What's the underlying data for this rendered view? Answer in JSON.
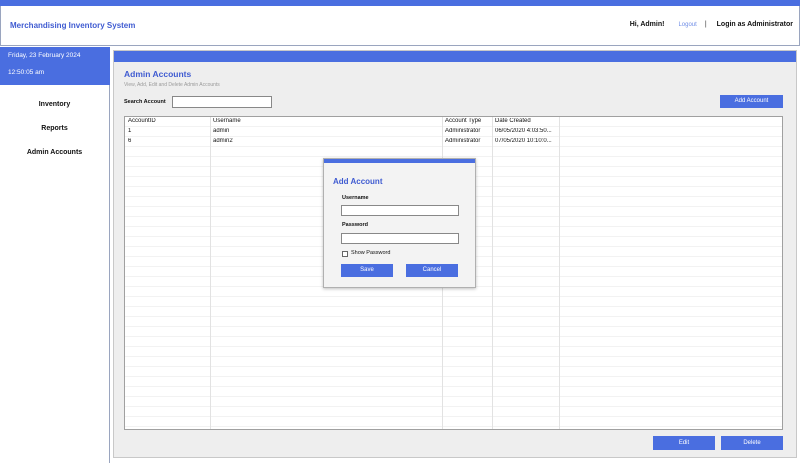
{
  "header": {
    "app_title": "Merchandising Inventory System",
    "greeting": "Hi, Admin!",
    "logout_label": "Logout",
    "separator": "|",
    "login_as": "Login as Administrator"
  },
  "sidebar": {
    "date": "Friday, 23 February 2024",
    "time": "12:50:05 am",
    "items": [
      {
        "label": "Inventory"
      },
      {
        "label": "Reports"
      },
      {
        "label": "Admin Accounts"
      }
    ]
  },
  "main": {
    "title": "Admin Accounts",
    "subtitle": "View, Add, Edit and Delete Admin Accounts",
    "search_label": "Search Account",
    "search_value": "",
    "add_button": "Add Account",
    "edit_button": "Edit",
    "delete_button": "Delete"
  },
  "table": {
    "columns": [
      "AccountID",
      "Username",
      "Account Type",
      "Date Created"
    ],
    "rows": [
      [
        "1",
        "admin",
        "Administrator",
        "06/05/2020 4:03:50..."
      ],
      [
        "6",
        "admin2",
        "Administrator",
        "07/05/2020 10:10:0..."
      ]
    ]
  },
  "dialog": {
    "title": "Add Account",
    "username_label": "Username",
    "username_value": "",
    "password_label": "Password",
    "password_value": "",
    "show_password_label": "Show Password",
    "save_button": "Save",
    "cancel_button": "Cancel"
  },
  "colors": {
    "accent": "#4a6ee0",
    "title_blue": "#3f5bd1",
    "panel_bg": "#eeeeee"
  }
}
